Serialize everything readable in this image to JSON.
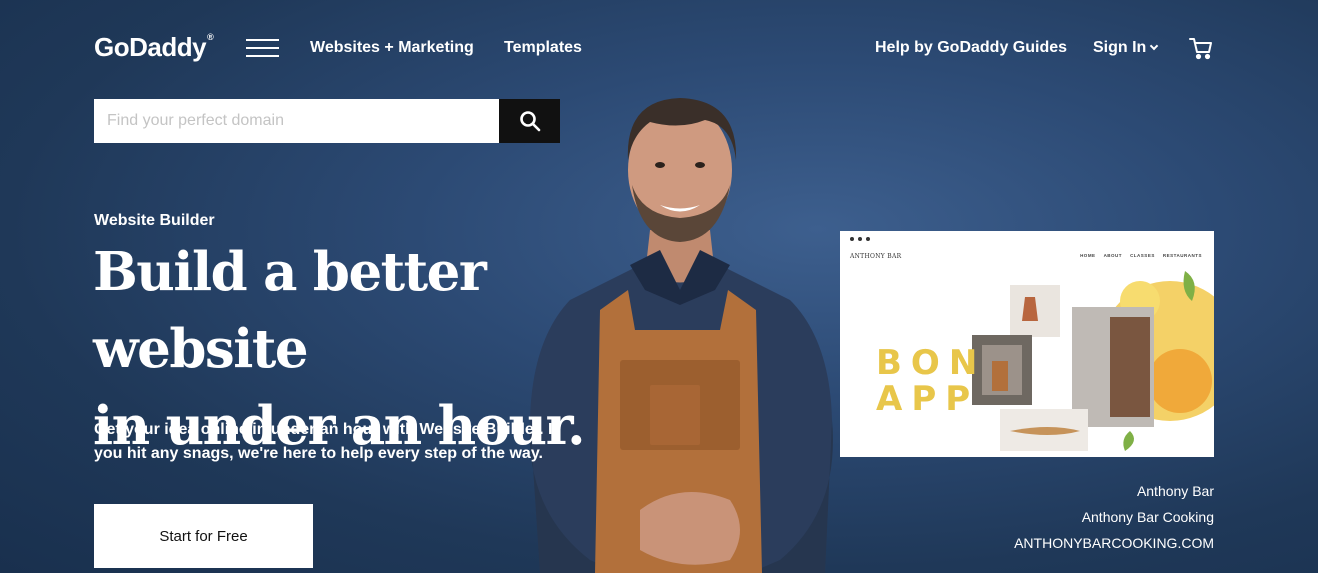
{
  "header": {
    "logo": "GoDaddy",
    "logo_mark": "®",
    "menu_icon": "hamburger-icon",
    "nav_websites": "Websites + Marketing",
    "nav_templates": "Templates",
    "nav_help": "Help by GoDaddy Guides",
    "nav_signin": "Sign In",
    "cart_icon": "cart-icon"
  },
  "search": {
    "placeholder": "Find your perfect domain",
    "value": "",
    "button_icon": "search-icon"
  },
  "hero": {
    "eyebrow": "Website Builder",
    "headline_line1": "Build a better website",
    "headline_line2": "in under an hour.",
    "subcopy": "Get your idea online in under an hour with Website Builder. If you hit any snags, we're here to help every step of the way.",
    "cta_label": "Start for Free"
  },
  "preview": {
    "brand": "ANTHONY BAR",
    "nav": [
      "HOME",
      "ABOUT",
      "CLASSES",
      "RESTAURANTS"
    ],
    "bon_line1": "BON",
    "bon_line2": "APP"
  },
  "caption": {
    "name": "Anthony Bar",
    "business": "Anthony Bar Cooking",
    "url": "ANTHONYBARCOOKING.COM"
  },
  "colors": {
    "background": "#2c4a74",
    "accent_yellow": "#e8c64a",
    "apron": "#b2703b"
  }
}
